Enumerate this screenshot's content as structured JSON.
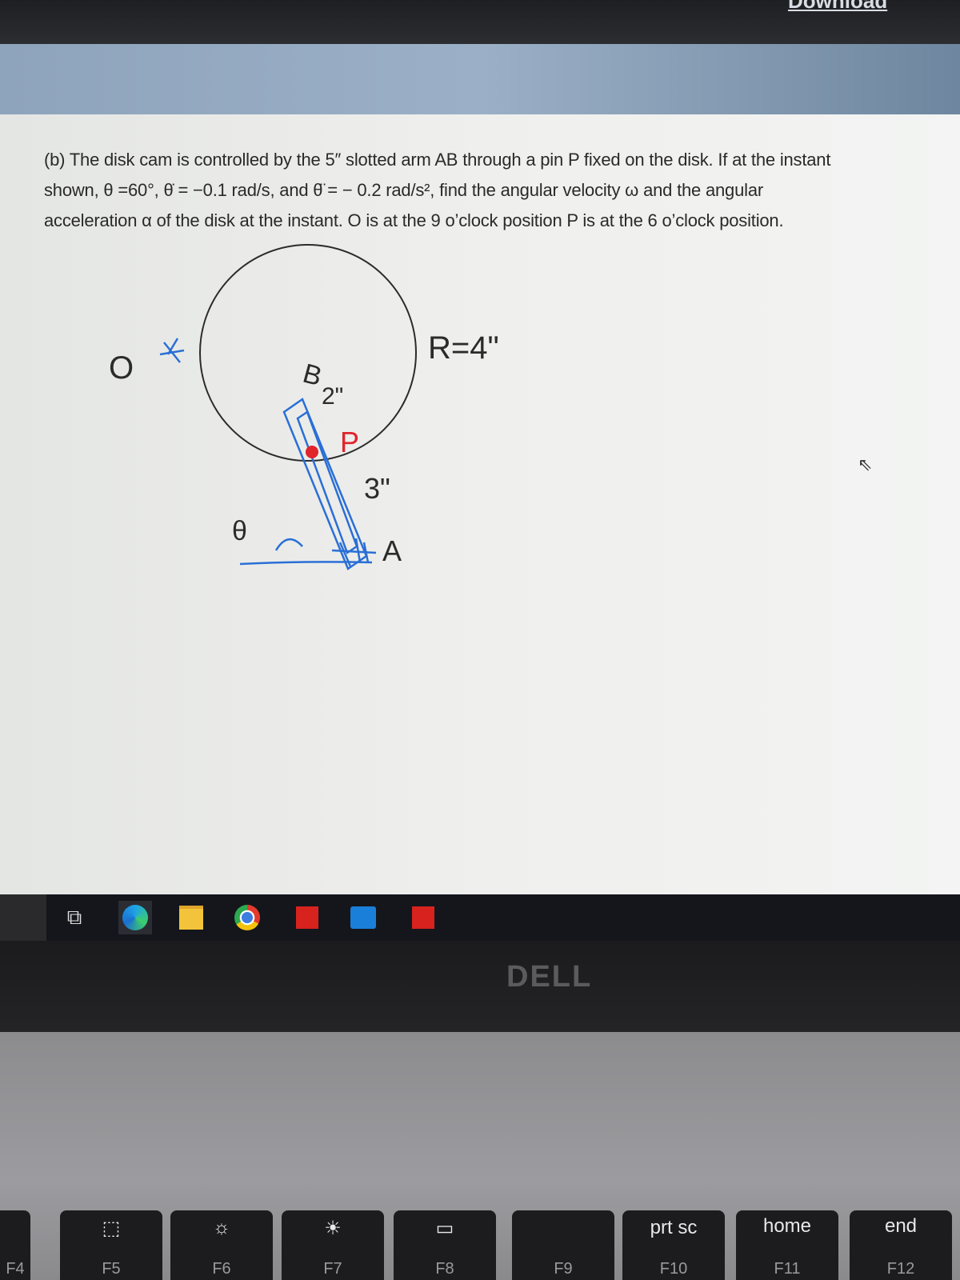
{
  "window": {
    "partial_button": "Download"
  },
  "problem": {
    "line1": "(b) The disk cam is controlled by the 5″ slotted arm AB through a pin P fixed on the disk.  If at the instant",
    "line2": "shown, θ =60°, θ̇ = −0.1 rad/s, and θ̈ = − 0.2 rad/s², find the angular velocity ω and the angular",
    "line3": "acceleration α of the disk at the instant.  O is at the 9 o’clock position P is at the 6 o’clock position."
  },
  "diagram": {
    "label_o": "O",
    "label_r": "R=4\"",
    "label_b": "B",
    "label_2in": "2\"",
    "label_p": "P",
    "label_3in": "3\"",
    "label_a": "A",
    "label_theta": "θ",
    "colors": {
      "ink": "#2b2b2b",
      "blue": "#2a6fd6",
      "red": "#e0242c"
    }
  },
  "taskbar": {
    "icons": [
      "task-view-icon",
      "edge-icon",
      "file-explorer-icon",
      "chrome-icon",
      "app-red-castle-icon",
      "outlook-icon",
      "app-red-castle-icon"
    ]
  },
  "bezel": {
    "logo": "DELL"
  },
  "keyboard": {
    "keys": [
      {
        "top": "",
        "fn": "F4"
      },
      {
        "top": "⬚",
        "fn": "F5"
      },
      {
        "top": "☼",
        "fn": "F6"
      },
      {
        "top": "☀",
        "fn": "F7"
      },
      {
        "top": "▭",
        "fn": "F8"
      },
      {
        "top": "",
        "fn": "F9"
      },
      {
        "top": "prt sc",
        "fn": "F10"
      },
      {
        "top": "home",
        "fn": "F11"
      },
      {
        "top": "end",
        "fn": "F12"
      }
    ]
  }
}
